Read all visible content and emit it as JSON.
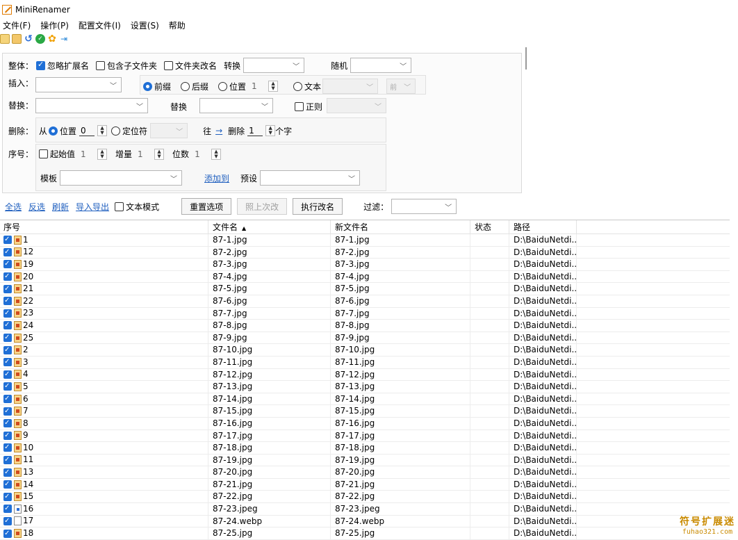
{
  "window": {
    "title": "MiniRenamer"
  },
  "menu": [
    "文件(F)",
    "操作(P)",
    "配置文件(I)",
    "设置(S)",
    "帮助"
  ],
  "toolbar_icons": [
    "page-icon",
    "copy-icon",
    "undo-icon",
    "ok-icon",
    "gear-icon",
    "pin-icon"
  ],
  "options": {
    "whole": {
      "label": "整体：",
      "ignore_ext": "忽略扩展名",
      "include_sub": "包含子文件夹",
      "folder_rename": "文件夹改名",
      "convert_label": "转换",
      "random_label": "随机"
    },
    "insert": {
      "label": "插入：",
      "prefix": "前缀",
      "suffix": "后缀",
      "position": "位置",
      "position_value": "1",
      "text": "文本",
      "front": "前"
    },
    "replace": {
      "label": "替换：",
      "replace_label": "替换",
      "regex": "正则"
    },
    "delete": {
      "label": "删除：",
      "from": "从",
      "position": "位置",
      "position_value": "0",
      "locator": "定位符",
      "toward": "往",
      "delete_label": "删除",
      "delete_count": "1",
      "chars": "个字"
    },
    "sequence": {
      "label": "序号：",
      "start": "起始值",
      "start_value": "1",
      "increment": "增量",
      "increment_value": "1",
      "digits": "位数",
      "digits_value": "1",
      "template": "模板",
      "add_to": "添加到",
      "preset": "预设"
    }
  },
  "actions": {
    "select_all": "全选",
    "invert": "反选",
    "refresh": "刷新",
    "import_export": "导入导出",
    "text_mode": "文本模式",
    "reset": "重置选项",
    "last_time": "照上次改",
    "execute": "执行改名",
    "filter": "过滤："
  },
  "table": {
    "columns": [
      "序号",
      "文件名",
      "新文件名",
      "状态",
      "路径"
    ],
    "rows": [
      {
        "no": "1",
        "name": "87-1.jpg",
        "new": "87-1.jpg",
        "path": "D:\\BaiduNetdi...",
        "icon": "image"
      },
      {
        "no": "12",
        "name": "87-2.jpg",
        "new": "87-2.jpg",
        "path": "D:\\BaiduNetdi...",
        "icon": "image"
      },
      {
        "no": "19",
        "name": "87-3.jpg",
        "new": "87-3.jpg",
        "path": "D:\\BaiduNetdi...",
        "icon": "image"
      },
      {
        "no": "20",
        "name": "87-4.jpg",
        "new": "87-4.jpg",
        "path": "D:\\BaiduNetdi...",
        "icon": "image"
      },
      {
        "no": "21",
        "name": "87-5.jpg",
        "new": "87-5.jpg",
        "path": "D:\\BaiduNetdi...",
        "icon": "image"
      },
      {
        "no": "22",
        "name": "87-6.jpg",
        "new": "87-6.jpg",
        "path": "D:\\BaiduNetdi...",
        "icon": "image"
      },
      {
        "no": "23",
        "name": "87-7.jpg",
        "new": "87-7.jpg",
        "path": "D:\\BaiduNetdi...",
        "icon": "image"
      },
      {
        "no": "24",
        "name": "87-8.jpg",
        "new": "87-8.jpg",
        "path": "D:\\BaiduNetdi...",
        "icon": "image"
      },
      {
        "no": "25",
        "name": "87-9.jpg",
        "new": "87-9.jpg",
        "path": "D:\\BaiduNetdi...",
        "icon": "image"
      },
      {
        "no": "2",
        "name": "87-10.jpg",
        "new": "87-10.jpg",
        "path": "D:\\BaiduNetdi...",
        "icon": "image"
      },
      {
        "no": "3",
        "name": "87-11.jpg",
        "new": "87-11.jpg",
        "path": "D:\\BaiduNetdi...",
        "icon": "image"
      },
      {
        "no": "4",
        "name": "87-12.jpg",
        "new": "87-12.jpg",
        "path": "D:\\BaiduNetdi...",
        "icon": "image"
      },
      {
        "no": "5",
        "name": "87-13.jpg",
        "new": "87-13.jpg",
        "path": "D:\\BaiduNetdi...",
        "icon": "image"
      },
      {
        "no": "6",
        "name": "87-14.jpg",
        "new": "87-14.jpg",
        "path": "D:\\BaiduNetdi...",
        "icon": "image"
      },
      {
        "no": "7",
        "name": "87-15.jpg",
        "new": "87-15.jpg",
        "path": "D:\\BaiduNetdi...",
        "icon": "image"
      },
      {
        "no": "8",
        "name": "87-16.jpg",
        "new": "87-16.jpg",
        "path": "D:\\BaiduNetdi...",
        "icon": "image"
      },
      {
        "no": "9",
        "name": "87-17.jpg",
        "new": "87-17.jpg",
        "path": "D:\\BaiduNetdi...",
        "icon": "image"
      },
      {
        "no": "10",
        "name": "87-18.jpg",
        "new": "87-18.jpg",
        "path": "D:\\BaiduNetdi...",
        "icon": "image"
      },
      {
        "no": "11",
        "name": "87-19.jpg",
        "new": "87-19.jpg",
        "path": "D:\\BaiduNetdi...",
        "icon": "image"
      },
      {
        "no": "13",
        "name": "87-20.jpg",
        "new": "87-20.jpg",
        "path": "D:\\BaiduNetdi...",
        "icon": "image"
      },
      {
        "no": "14",
        "name": "87-21.jpg",
        "new": "87-21.jpg",
        "path": "D:\\BaiduNetdi...",
        "icon": "image"
      },
      {
        "no": "15",
        "name": "87-22.jpg",
        "new": "87-22.jpg",
        "path": "D:\\BaiduNetdi...",
        "icon": "image"
      },
      {
        "no": "16",
        "name": "87-23.jpeg",
        "new": "87-23.jpeg",
        "path": "D:\\BaiduNetdi...",
        "icon": "jpeg"
      },
      {
        "no": "17",
        "name": "87-24.webp",
        "new": "87-24.webp",
        "path": "D:\\BaiduNetdi...",
        "icon": "blank"
      },
      {
        "no": "18",
        "name": "87-25.jpg",
        "new": "87-25.jpg",
        "path": "D:\\BaiduNetdi...",
        "icon": "image"
      }
    ]
  },
  "watermark": {
    "line1": "符号扩展迷",
    "line2": "fuhao321.com"
  },
  "colors": {
    "accent": "#1f6fd6",
    "link": "#1f5fbf"
  }
}
